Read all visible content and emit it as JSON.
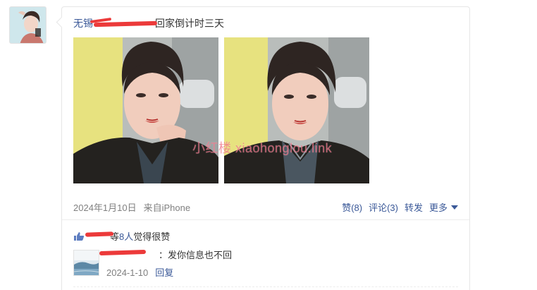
{
  "post": {
    "author": "无锡",
    "text": "回家倒计时三天",
    "watermark": "小红楼 xiaohonglou.link",
    "date": "2024年1月10日",
    "source": "来自iPhone"
  },
  "actions": {
    "like": "赞(8)",
    "comment": "评论(3)",
    "share": "转发",
    "more": "更多"
  },
  "likes": {
    "prefix": "等",
    "count": "8人",
    "suffix": "觉得很赞"
  },
  "comment": {
    "text": "：发你信息也不回",
    "date": "2024-1-10",
    "reply": "回复"
  },
  "colors": {
    "link": "#3b5998",
    "muted": "#808080",
    "redaction": "#ec3a3a"
  }
}
